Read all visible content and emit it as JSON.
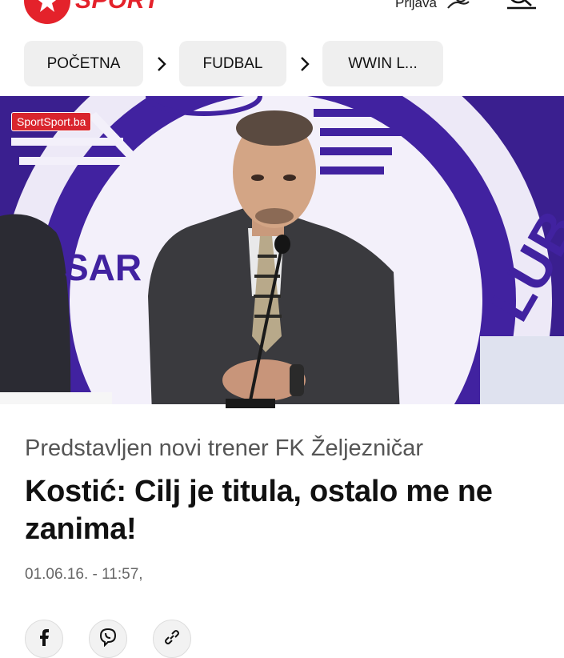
{
  "header": {
    "brand": "SPORT",
    "login_label": "Prijava"
  },
  "breadcrumb": {
    "items": [
      "POČETNA",
      "FUDBAL",
      "WWIN L..."
    ]
  },
  "hero": {
    "watermark": "SportSport.ba",
    "backdrop_text_1": "SAR",
    "backdrop_text_2": "LUB"
  },
  "article": {
    "subtitle": "Predstavljen novi trener FK Željezničar",
    "title": "Kostić: Cilj je titula, ostalo me ne zanima!",
    "datetime": "01.06.16. - 11:57,"
  },
  "share": {
    "buttons": [
      "facebook-icon",
      "viber-icon",
      "link-icon"
    ]
  },
  "colors": {
    "brand_red": "#e4222b",
    "backdrop_purple": "#3a1f8f"
  }
}
